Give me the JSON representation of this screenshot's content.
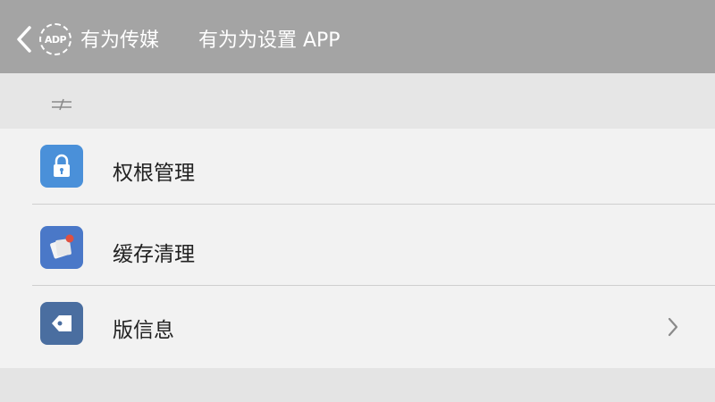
{
  "header": {
    "back_badge": "ADP",
    "brand": "有为传媒",
    "title": "有为为设置 APP"
  },
  "section": {
    "icon": "sliders-icon"
  },
  "items": [
    {
      "label": "权根管理",
      "icon": "lock-icon",
      "icon_color": "#4a90d9",
      "has_chevron": false
    },
    {
      "label": "缓存清理",
      "icon": "cache-clean-icon",
      "icon_color": "#4a78c8",
      "has_chevron": false
    },
    {
      "label": "版信息",
      "icon": "tag-icon",
      "icon_color": "#4a6ea0",
      "has_chevron": true
    }
  ],
  "colors": {
    "header_bg": "#a4a4a4",
    "list_bg": "#f2f2f2",
    "badge_red": "#e05040"
  }
}
